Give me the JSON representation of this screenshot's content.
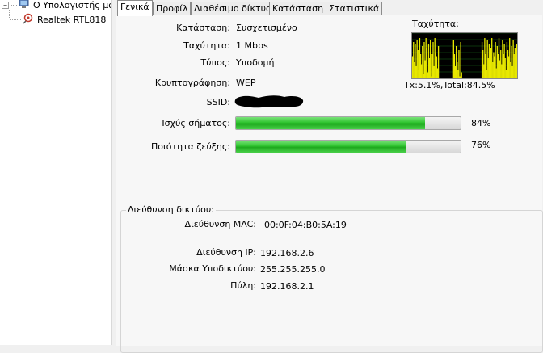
{
  "tree": {
    "root_label": "Ο Υπολογιστής μο",
    "root_expander": "−",
    "child_label": "Realtek RTL818"
  },
  "tabs": [
    {
      "label": "Γενικά",
      "active": true
    },
    {
      "label": "Προφίλ",
      "active": false
    },
    {
      "label": "Διαθέσιμο δίκτυο",
      "active": false
    },
    {
      "label": "Κατάσταση",
      "active": false
    },
    {
      "label": "Στατιστικά",
      "active": false
    }
  ],
  "general": {
    "status_label": "Κατάσταση:",
    "status_value": "Συσχετισμένο",
    "speed_label": "Ταχύτητα:",
    "speed_value": "1 Mbps",
    "type_label": "Τύπος:",
    "type_value": "Υποδομή",
    "encryption_label": "Κρυπτογράφηση:",
    "encryption_value": "WEP",
    "ssid_label": "SSID:",
    "signal_label": "Ισχύς σήματος:",
    "signal_percent_text": "84%",
    "signal_value": 0.84,
    "quality_label": "Ποιότητα ζεύξης:",
    "quality_percent_text": "76%",
    "quality_value": 0.76
  },
  "throughput": {
    "title": "Ταχύτητα:",
    "stats": "Tx:5.1%,Total:84.5%",
    "colors": {
      "background": "#000000",
      "fill": "#e8e800",
      "grid": "#1a6b1a"
    },
    "levels": [
      0.55,
      0.9,
      0.4,
      0.85,
      0.3,
      0.95,
      0.7,
      0.2,
      1.0,
      0.6,
      0.35,
      0.8,
      0.1,
      0.9,
      0.45,
      1.0,
      0.75,
      0.15,
      0.85,
      0.5,
      0.95,
      0.05,
      0.6,
      0.9,
      0.3,
      1.0,
      0.65,
      0.55,
      0.25,
      0.8,
      0.0,
      0.0,
      0.0,
      0.0,
      0.0,
      0.0,
      0.0,
      0.0,
      0.0,
      0.0,
      0.0,
      0.0,
      0.0,
      0.0,
      0.0,
      0.0,
      0.95,
      0.6,
      0.3,
      0.8,
      0.4,
      0.2,
      0.7,
      0.05,
      0.9,
      0.15,
      0.0,
      0.0,
      0.0,
      0.0,
      0.0,
      0.0,
      0.0,
      0.0,
      0.0,
      0.0,
      0.0,
      0.0,
      0.0,
      0.0,
      0.0,
      0.0,
      0.0,
      0.0,
      0.0,
      0.0,
      0.0,
      0.0,
      0.9,
      0.7,
      0.35,
      1.0,
      0.6,
      0.2,
      0.95,
      0.5,
      0.85,
      0.3,
      0.75,
      1.0,
      0.4,
      0.65,
      0.55,
      0.9,
      0.25,
      0.8,
      0.6,
      1.0,
      0.45,
      0.7,
      0.35,
      0.95,
      0.6,
      0.85,
      0.5,
      0.2,
      0.9,
      0.7,
      0.55,
      1.0,
      0.4,
      0.8,
      0.3,
      0.95,
      0.6,
      0.75,
      0.5,
      0.85
    ]
  },
  "network_address": {
    "group_title": "Διεύθυνση δικτύου:",
    "mac_label": "Διεύθυνση MAC:",
    "mac_value": "00:0F:04:B0:5A:19",
    "ip_label": "Διεύθυνση IP:",
    "ip_value": "192.168.2.6",
    "mask_label": "Μάσκα Υποδικτύου:",
    "mask_value": "255.255.255.0",
    "gateway_label": "Πύλη:",
    "gateway_value": "192.168.2.1"
  }
}
